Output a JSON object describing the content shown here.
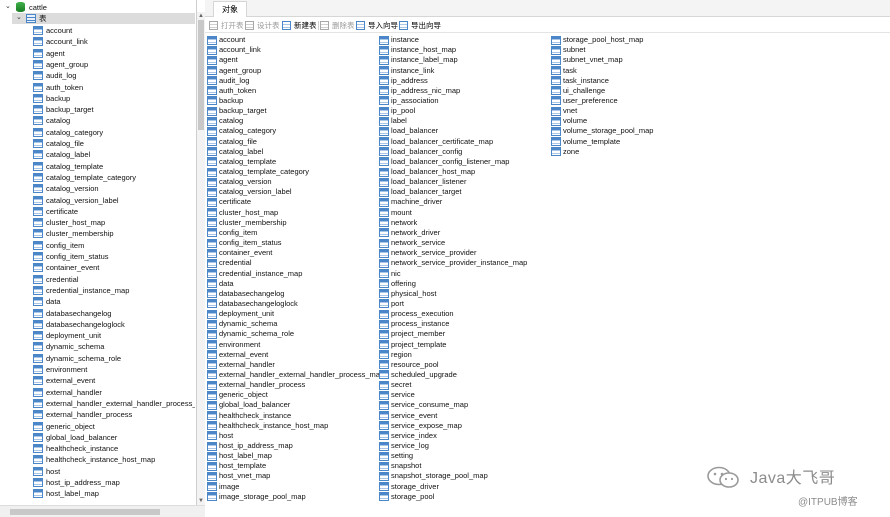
{
  "tree": {
    "database": "cattle",
    "group": "表",
    "tables": [
      "account",
      "account_link",
      "agent",
      "agent_group",
      "audit_log",
      "auth_token",
      "backup",
      "backup_target",
      "catalog",
      "catalog_category",
      "catalog_file",
      "catalog_label",
      "catalog_template",
      "catalog_template_category",
      "catalog_version",
      "catalog_version_label",
      "certificate",
      "cluster_host_map",
      "cluster_membership",
      "config_item",
      "config_item_status",
      "container_event",
      "credential",
      "credential_instance_map",
      "data",
      "databasechangelog",
      "databasechangeloglock",
      "deployment_unit",
      "dynamic_schema",
      "dynamic_schema_role",
      "environment",
      "external_event",
      "external_handler",
      "external_handler_external_handler_process_ma",
      "external_handler_process",
      "generic_object",
      "global_load_balancer",
      "healthcheck_instance",
      "healthcheck_instance_host_map",
      "host",
      "host_ip_address_map",
      "host_label_map"
    ]
  },
  "tabs": [
    {
      "label": "对象"
    }
  ],
  "toolbar": {
    "open": "打开表",
    "design": "设计表",
    "new": "新建表",
    "delete": "删除表",
    "import": "导入向导",
    "export": "导出向导"
  },
  "objects": {
    "col1": [
      "account",
      "account_link",
      "agent",
      "agent_group",
      "audit_log",
      "auth_token",
      "backup",
      "backup_target",
      "catalog",
      "catalog_category",
      "catalog_file",
      "catalog_label",
      "catalog_template",
      "catalog_template_category",
      "catalog_version",
      "catalog_version_label",
      "certificate",
      "cluster_host_map",
      "cluster_membership",
      "config_item",
      "config_item_status",
      "container_event",
      "credential",
      "credential_instance_map",
      "data",
      "databasechangelog",
      "databasechangeloglock",
      "deployment_unit",
      "dynamic_schema",
      "dynamic_schema_role",
      "environment",
      "external_event",
      "external_handler",
      "external_handler_external_handler_process_map",
      "external_handler_process",
      "generic_object",
      "global_load_balancer",
      "healthcheck_instance",
      "healthcheck_instance_host_map",
      "host",
      "host_ip_address_map",
      "host_label_map",
      "host_template",
      "host_vnet_map",
      "image",
      "image_storage_pool_map"
    ],
    "col2": [
      "instance",
      "instance_host_map",
      "instance_label_map",
      "instance_link",
      "ip_address",
      "ip_address_nic_map",
      "ip_association",
      "ip_pool",
      "label",
      "load_balancer",
      "load_balancer_certificate_map",
      "load_balancer_config",
      "load_balancer_config_listener_map",
      "load_balancer_host_map",
      "load_balancer_listener",
      "load_balancer_target",
      "machine_driver",
      "mount",
      "network",
      "network_driver",
      "network_service",
      "network_service_provider",
      "network_service_provider_instance_map",
      "nic",
      "offering",
      "physical_host",
      "port",
      "process_execution",
      "process_instance",
      "project_member",
      "project_template",
      "region",
      "resource_pool",
      "scheduled_upgrade",
      "secret",
      "service",
      "service_consume_map",
      "service_event",
      "service_expose_map",
      "service_index",
      "service_log",
      "setting",
      "snapshot",
      "snapshot_storage_pool_map",
      "storage_driver",
      "storage_pool"
    ],
    "col3": [
      "storage_pool_host_map",
      "subnet",
      "subnet_vnet_map",
      "task",
      "task_instance",
      "ui_challenge",
      "user_preference",
      "vnet",
      "volume",
      "volume_storage_pool_map",
      "volume_template",
      "zone"
    ]
  },
  "watermark": {
    "title": "Java大飞哥",
    "sub": "@ITPUB博客"
  },
  "colors": {
    "table_icon": "#4a86c8",
    "db_icon": "#2e9b39",
    "selection": "#dcdcdc"
  }
}
